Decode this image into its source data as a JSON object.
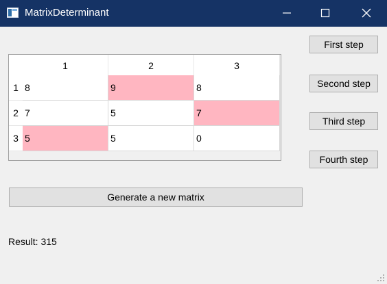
{
  "window": {
    "title": "MatrixDeterminant",
    "icon": "app-window-icon",
    "controls": [
      "minimize-icon",
      "maximize-icon",
      "close-icon"
    ]
  },
  "grid": {
    "column_headers": [
      "1",
      "2",
      "3"
    ],
    "row_headers": [
      "1",
      "2",
      "3"
    ],
    "rows": [
      [
        {
          "value": "8",
          "highlighted": false
        },
        {
          "value": "9",
          "highlighted": true
        },
        {
          "value": "8",
          "highlighted": false
        }
      ],
      [
        {
          "value": "7",
          "highlighted": false
        },
        {
          "value": "5",
          "highlighted": false
        },
        {
          "value": "7",
          "highlighted": true
        }
      ],
      [
        {
          "value": "5",
          "highlighted": true
        },
        {
          "value": "5",
          "highlighted": false
        },
        {
          "value": "0",
          "highlighted": false
        }
      ]
    ],
    "highlight_color": "#ffb6c1"
  },
  "buttons": {
    "first_step": "First step",
    "second_step": "Second step",
    "third_step": "Third step",
    "fourth_step": "Fourth step",
    "generate": "Generate a new matrix"
  },
  "result": {
    "text": "Result: 315"
  },
  "colors": {
    "titlebar": "#153365",
    "background": "#f0f0f0",
    "button": "#e1e1e1"
  }
}
